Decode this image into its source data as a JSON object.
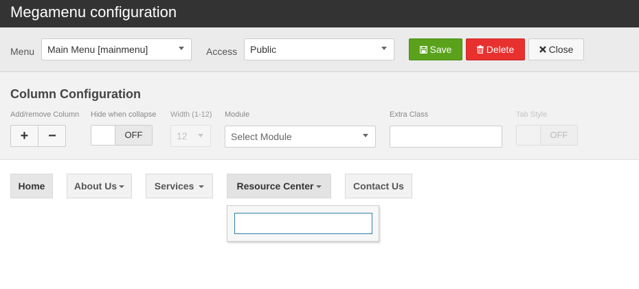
{
  "app": {
    "title": "Megamenu configuration"
  },
  "toolbar": {
    "menu_label": "Menu",
    "menu_value": "Main Menu [mainmenu]",
    "access_label": "Access",
    "access_value": "Public",
    "save_label": "Save",
    "delete_label": "Delete",
    "close_label": "Close"
  },
  "column_config": {
    "title": "Column Configuration",
    "add_remove_label": "Add/remove Column",
    "plus": "+",
    "minus": "−",
    "hide_label": "Hide when collapse",
    "hide_state": "OFF",
    "width_label": "Width (1-12)",
    "width_value": "12",
    "module_label": "Module",
    "module_placeholder": "Select Module",
    "extra_class_label": "Extra Class",
    "extra_class_value": "",
    "tab_style_label": "Tab Style",
    "tab_style_state": "OFF"
  },
  "nav": {
    "items": [
      {
        "label": "Home",
        "dropdown": false
      },
      {
        "label": "About Us",
        "dropdown": true
      },
      {
        "label": "Services",
        "dropdown": true
      },
      {
        "label": "Resource Center",
        "dropdown": true,
        "active": true
      },
      {
        "label": "Contact Us",
        "dropdown": false
      }
    ]
  },
  "colors": {
    "titlebar": "#333333",
    "save": "#5aa21c",
    "delete": "#e8312f",
    "focus_border": "#2a7fa8"
  },
  "icons": {
    "save": "floppy-disk-icon",
    "delete": "trash-icon",
    "close": "x-icon"
  }
}
